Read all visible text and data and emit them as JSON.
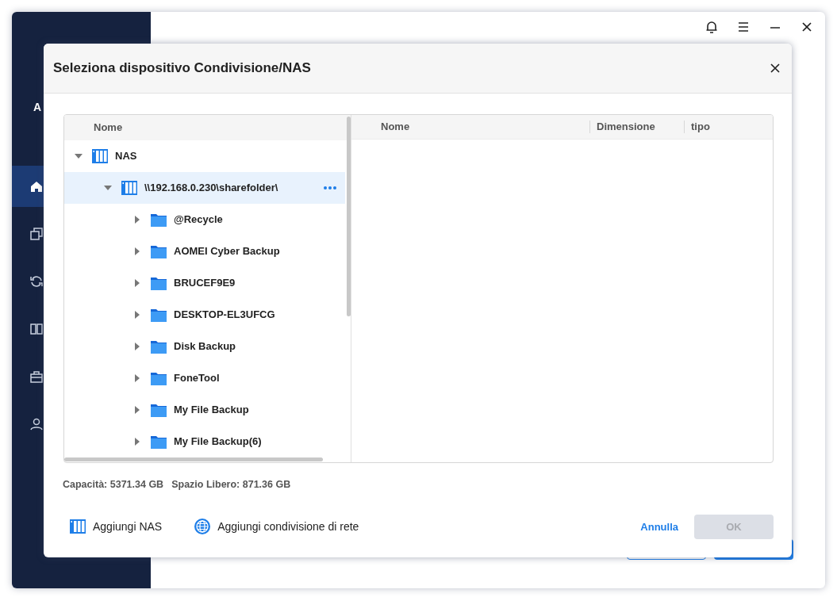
{
  "app": {
    "brand": "A",
    "nav": [
      {
        "kind": "home",
        "selected": true
      },
      {
        "kind": "clone",
        "selected": false
      },
      {
        "kind": "sync",
        "selected": false
      },
      {
        "kind": "columns",
        "selected": false
      },
      {
        "kind": "tools",
        "selected": false
      },
      {
        "kind": "user",
        "selected": false
      }
    ]
  },
  "dialog": {
    "title": "Seleziona dispositivo Condivisione/NAS",
    "tree_header": "Nome",
    "list_columns": [
      "Nome",
      "Dimensione",
      "tipo"
    ],
    "tree": [
      {
        "label": "NAS",
        "kind": "nas",
        "expanded": true,
        "selected": false,
        "children": [
          {
            "label": "\\\\192.168.0.230\\sharefolder\\",
            "kind": "nas",
            "expanded": true,
            "selected": true,
            "children": [
              {
                "label": "@Recycle",
                "kind": "folder",
                "expanded": false,
                "selected": false
              },
              {
                "label": "AOMEI Cyber Backup",
                "kind": "folder",
                "expanded": false,
                "selected": false
              },
              {
                "label": "BRUCEF9E9",
                "kind": "folder",
                "expanded": false,
                "selected": false
              },
              {
                "label": "DESKTOP-EL3UFCG",
                "kind": "folder",
                "expanded": false,
                "selected": false
              },
              {
                "label": "Disk Backup",
                "kind": "folder",
                "expanded": false,
                "selected": false
              },
              {
                "label": "FoneTool",
                "kind": "folder",
                "expanded": false,
                "selected": false
              },
              {
                "label": "My File Backup",
                "kind": "folder",
                "expanded": false,
                "selected": false
              },
              {
                "label": "My File Backup(6)",
                "kind": "folder",
                "expanded": false,
                "selected": false
              }
            ]
          }
        ]
      }
    ],
    "status": [
      "Capacità: 5371.34 GB",
      "Spazio Libero: 871.36 GB"
    ],
    "actions": [
      {
        "label": "Aggiungi NAS",
        "kind": "nas"
      },
      {
        "label": "Aggiungi condivisione di rete",
        "kind": "network"
      }
    ],
    "cancel": "Annulla",
    "ok": {
      "label": "OK",
      "disabled": true
    }
  }
}
